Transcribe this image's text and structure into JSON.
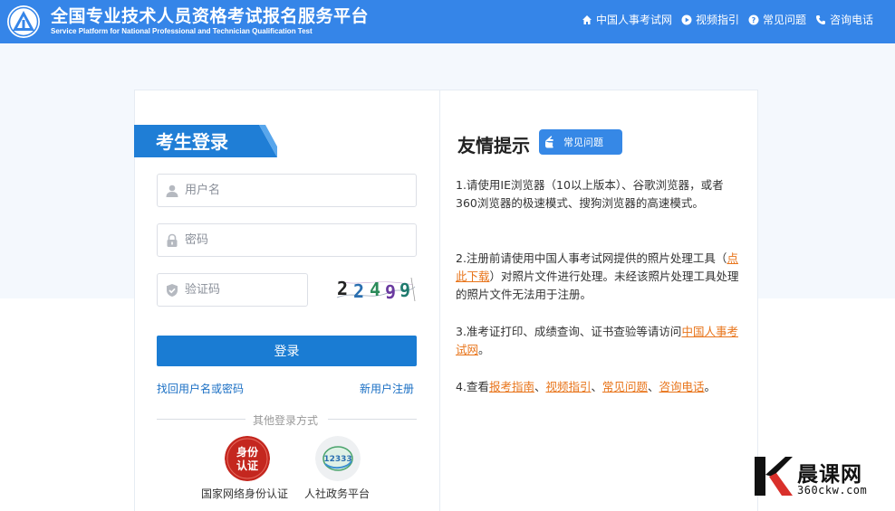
{
  "header": {
    "title": "全国专业技术人员资格考试报名服务平台",
    "subtitle": "Service Platform for National Professional and Technician Qualification Test",
    "nav": [
      {
        "label": "中国人事考试网",
        "icon": "home-icon"
      },
      {
        "label": "视频指引",
        "icon": "play-icon"
      },
      {
        "label": "常见问题",
        "icon": "question-icon"
      },
      {
        "label": "咨询电话",
        "icon": "phone-icon"
      }
    ]
  },
  "login": {
    "title": "考生登录",
    "username_placeholder": "用户名",
    "password_placeholder": "密码",
    "captcha_placeholder": "验证码",
    "captcha_text": "22499",
    "submit_label": "登录",
    "forgot_label": "找回用户名或密码",
    "register_label": "新用户注册",
    "other_methods_title": "其他登录方式",
    "other_methods": [
      {
        "label": "国家网络身份认证",
        "badge": "身份认证"
      },
      {
        "label": "人社政务平台",
        "badge": "12333"
      }
    ]
  },
  "tips": {
    "title": "友情提示",
    "faq_label": "常见问题",
    "items": [
      {
        "text": "1.请使用IE浏览器（10以上版本）、谷歌浏览器，或者360浏览器的极速模式、搜狗浏览器的高速模式。"
      },
      {
        "before": "2.注册前请使用中国人事考试网提供的照片处理工具（",
        "link": "点此下载",
        "after": "）对照片文件进行处理。未经该照片处理工具处理的照片文件无法用于注册。"
      },
      {
        "before": "3.准考证打印、成绩查询、证书查验等请访问",
        "link": "中国人事考试网",
        "after": "。"
      },
      {
        "before": "4.查看",
        "links": [
          "报考指南",
          "视频指引",
          "常见问题",
          "咨询电话"
        ],
        "separator": "、",
        "after": "。"
      }
    ]
  },
  "watermark": {
    "name": "晨课网",
    "url": "360ckw.com"
  },
  "colors": {
    "header_bg": "#3585e8",
    "primary_button": "#1a7cd3",
    "link_orange": "#e8741a",
    "link_blue": "#1a6fc4"
  }
}
